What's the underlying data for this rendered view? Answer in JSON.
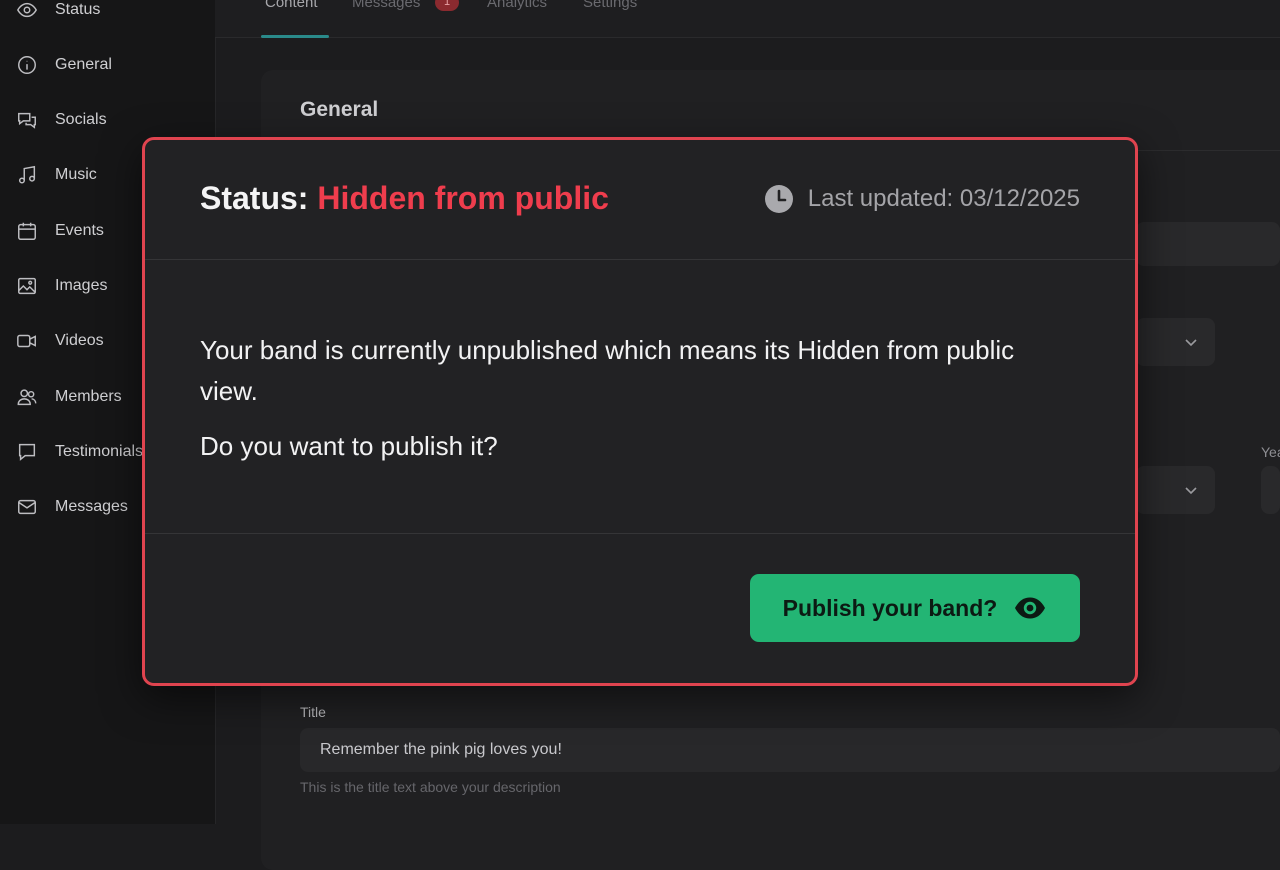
{
  "sidebar": {
    "items": [
      {
        "label": "Status",
        "icon": "eye-icon"
      },
      {
        "label": "General",
        "icon": "info-icon"
      },
      {
        "label": "Socials",
        "icon": "chat-bubbles-icon"
      },
      {
        "label": "Music",
        "icon": "music-note-icon"
      },
      {
        "label": "Events",
        "icon": "calendar-icon"
      },
      {
        "label": "Images",
        "icon": "image-icon"
      },
      {
        "label": "Videos",
        "icon": "video-camera-icon"
      },
      {
        "label": "Members",
        "icon": "users-icon"
      },
      {
        "label": "Testimonials",
        "icon": "message-bubble-icon"
      },
      {
        "label": "Messages",
        "icon": "envelope-icon"
      }
    ]
  },
  "tabs": [
    {
      "label": "Content",
      "active": true
    },
    {
      "label": "Messages",
      "badge": "1"
    },
    {
      "label": "Analytics"
    },
    {
      "label": "Settings"
    }
  ],
  "card": {
    "title": "General",
    "peek_label": "Yea",
    "title_field": {
      "label": "Title",
      "value": "Remember the pink pig loves you!",
      "help": "This is the title text above your description"
    }
  },
  "modal": {
    "status_prefix": "Status:",
    "status_value": "Hidden from public",
    "last_updated": "Last updated: 03/12/2025",
    "body_line1": "Your band is currently unpublished which means its Hidden from public view.",
    "body_line2": "Do you want to publish it?",
    "publish_label": "Publish your band?"
  },
  "colors": {
    "accent_danger": "#ef3d4d",
    "modal_border": "#e0444f",
    "publish_green": "#23b574",
    "tab_accent": "#2a8a8a"
  }
}
